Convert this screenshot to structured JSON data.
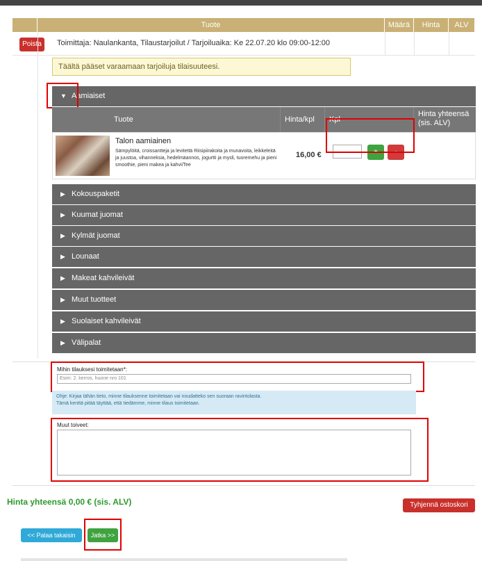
{
  "header": {
    "cols": [
      "Tuote",
      "Määrä",
      "Hinta",
      "ALV"
    ]
  },
  "supplier": {
    "delete_label": "Poista",
    "text": "Toimittaja: Naulankanta, Tilaustarjoilut / Tarjoiluaika: Ke 22.07.20 klo 09:00-12:00"
  },
  "info_notice": "Täältä pääset varaamaan tarjoiluja tilaisuuteesi.",
  "categories": {
    "open": "Aamiaiset",
    "closed": [
      "Kokouspaketit",
      "Kuumat juomat",
      "Kylmät juomat",
      "Lounaat",
      "Makeat kahvileivät",
      "Muut tuotteet",
      "Suolaiset kahvileivät",
      "Välipalat"
    ]
  },
  "product_table": {
    "headers": [
      "Tuote",
      "Hinta/kpl",
      "Kpl",
      "Hinta yhteensä\n(sis. ALV)"
    ],
    "product": {
      "title": "Talon aamiainen",
      "description": "Sämpylöitä, croissantteja ja levitettä Riisipiirakoita ja munavoita, leikkeleitä ja juustoa, vihanneksia, hedelmäannos, jogurtti ja mysli, tuoremehu ja pieni smoothie, pieni makea ja kahvi/Tee",
      "price": "16,00 €",
      "plus": "+",
      "minus": "-"
    }
  },
  "delivery": {
    "label": "Mihin tilauksesi toimitetaan*:",
    "placeholder": "Esim: 2. kerros, huone nro 101",
    "help_line1": "Ohje: Kirjaa tähän tieto, minne tilauksenne toimitetaan vai noudatteko sen suoraan ravintolasta.",
    "help_line2": "Tämä kenttä pitää täyttää, että tiedämme, minne tilaus toimitetaan."
  },
  "wishes": {
    "label": "Muut toiveet:"
  },
  "footer": {
    "total": "Hinta yhteensä 0,00 € (sis. ALV)",
    "clear_label": "Tyhjennä ostoskori",
    "back_label": "<< Palaa takaisin",
    "next_label": "Jatka >>"
  },
  "colors": {
    "header_gold": "#c9b074",
    "category_gray": "#666666",
    "accent_green": "#3fa33f",
    "accent_red": "#c9302c",
    "highlight_red": "#e00000"
  }
}
